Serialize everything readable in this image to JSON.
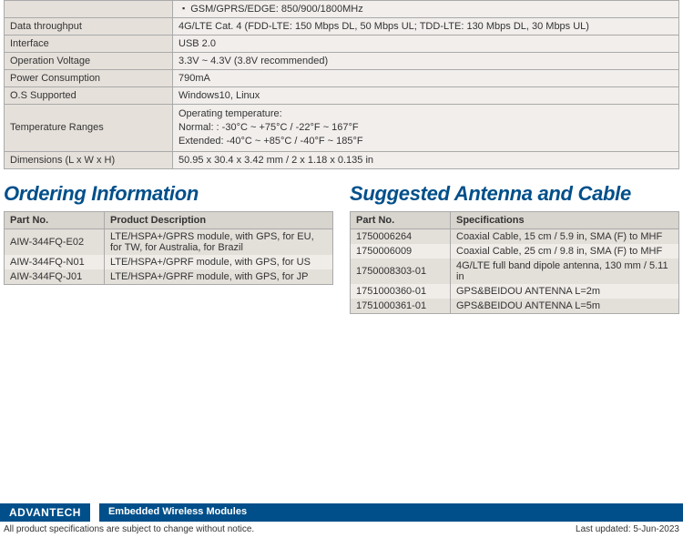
{
  "spec_table": {
    "rows": [
      {
        "label": "",
        "value_bullets": [
          "GSM/GPRS/EDGE: 850/900/1800MHz"
        ]
      },
      {
        "label": "Data throughput",
        "value": "4G/LTE Cat. 4 (FDD-LTE: 150 Mbps DL, 50 Mbps UL; TDD-LTE: 130 Mbps DL, 30 Mbps UL)"
      },
      {
        "label": "Interface",
        "value": "USB 2.0"
      },
      {
        "label": "Operation Voltage",
        "value": "3.3V ~ 4.3V (3.8V recommended)"
      },
      {
        "label": "Power Consumption",
        "value": "790mA"
      },
      {
        "label": "O.S Supported",
        "value": "Windows10, Linux"
      },
      {
        "label": "Temperature Ranges",
        "value_lines": [
          "Operating temperature:",
          "Normal: : -30°C ~ +75°C / -22°F ~ 167°F",
          "Extended: -40°C ~ +85°C / -40°F ~ 185°F"
        ]
      },
      {
        "label": "Dimensions (L x W x H)",
        "value": "50.95 x 30.4 x 3.42 mm / 2 x 1.18 x 0.135 in"
      }
    ]
  },
  "ordering": {
    "title": "Ordering Information",
    "headers": {
      "pn": "Part No.",
      "desc": "Product Description"
    },
    "rows": [
      {
        "pn": "AIW-344FQ-E02",
        "desc": "LTE/HSPA+/GPRS module, with GPS, for EU, for TW, for Australia, for Brazil"
      },
      {
        "pn": "AIW-344FQ-N01",
        "desc": "LTE/HSPA+/GPRF module, with GPS, for US"
      },
      {
        "pn": "AIW-344FQ-J01",
        "desc": "LTE/HSPA+/GPRF module, with GPS, for JP"
      }
    ]
  },
  "antenna": {
    "title": "Suggested Antenna and Cable",
    "headers": {
      "pn": "Part No.",
      "spec": "Specifications"
    },
    "rows": [
      {
        "pn": "1750006264",
        "spec": "Coaxial Cable, 15 cm / 5.9 in, SMA (F) to MHF"
      },
      {
        "pn": "1750006009",
        "spec": "Coaxial Cable, 25 cm / 9.8 in, SMA (F) to MHF"
      },
      {
        "pn": "1750008303-01",
        "spec": "4G/LTE full band dipole antenna, 130 mm / 5.11 in"
      },
      {
        "pn": "1751000360-01",
        "spec": "GPS&BEIDOU ANTENNA L=2m"
      },
      {
        "pn": "1751000361-01",
        "spec": "GPS&BEIDOU ANTENNA L=5m"
      }
    ]
  },
  "footer": {
    "logo": "ADVANTECH",
    "category": "Embedded Wireless Modules",
    "disclaimer": "All product specifications are subject to change without notice.",
    "updated": "Last updated: 5-Jun-2023"
  }
}
